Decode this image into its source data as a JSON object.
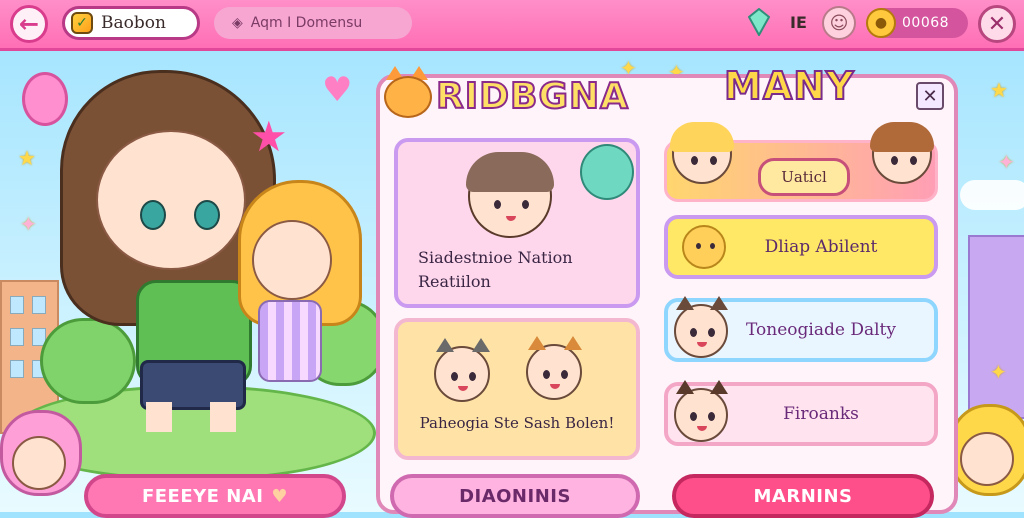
{
  "header": {
    "back_icon": "arrow-left-icon",
    "title": "Baobon",
    "title_icon": "shield-check-icon",
    "search_text": "Aqm I Domensu",
    "search_icon": "gem-small-icon",
    "resource_label": "IE",
    "coins": "00068",
    "coin_icon": "coin-icon",
    "gem_icon": "gem-icon",
    "face_icon": "face-icon",
    "close_icon": "close-icon"
  },
  "panel": {
    "title_left": "RIDBGNA",
    "title_right": "MANY",
    "close_icon": "close-icon",
    "card_pink_label": "Siadestnioe Nation Reatiilon",
    "card_yellow_label": "Paheogia Ste Sash Bolen!",
    "banner_button": "Uaticl",
    "options": [
      {
        "label": "Dliap Abilent",
        "icon": "bear-avatar-icon"
      },
      {
        "label": "Toneogiade Dalty",
        "icon": "cat-avatar-icon"
      },
      {
        "label": "Firoanks",
        "icon": "cat-avatar-icon"
      }
    ]
  },
  "buttons": {
    "left": "FEEEYE NAI",
    "left_icon": "heart-icon",
    "middle": "DIAONINIS",
    "right": "MARNINS"
  },
  "colors": {
    "topbar": "#ff7fbf",
    "panel_border": "#e088b8",
    "accent_yellow": "#ffe066",
    "accent_red": "#ff4f8a"
  }
}
